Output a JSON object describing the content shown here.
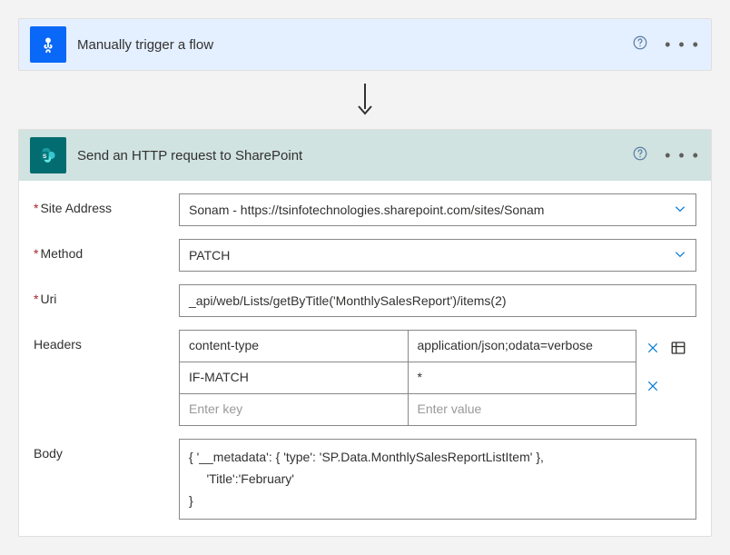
{
  "trigger": {
    "title": "Manually trigger a flow"
  },
  "action": {
    "title": "Send an HTTP request to SharePoint",
    "labels": {
      "siteAddress": "Site Address",
      "method": "Method",
      "uri": "Uri",
      "headers": "Headers",
      "body": "Body"
    },
    "siteAddress": "Sonam - https://tsinfotechnologies.sharepoint.com/sites/Sonam",
    "method": "PATCH",
    "uri": "_api/web/Lists/getByTitle('MonthlySalesReport')/items(2)",
    "headers": [
      {
        "key": "content-type",
        "value": "application/json;odata=verbose"
      },
      {
        "key": "IF-MATCH",
        "value": "*"
      }
    ],
    "headersPlaceholder": {
      "key": "Enter key",
      "value": "Enter value"
    },
    "body": "{ '__metadata': { 'type': 'SP.Data.MonthlySalesReportListItem' },\n     'Title':'February'\n}"
  }
}
